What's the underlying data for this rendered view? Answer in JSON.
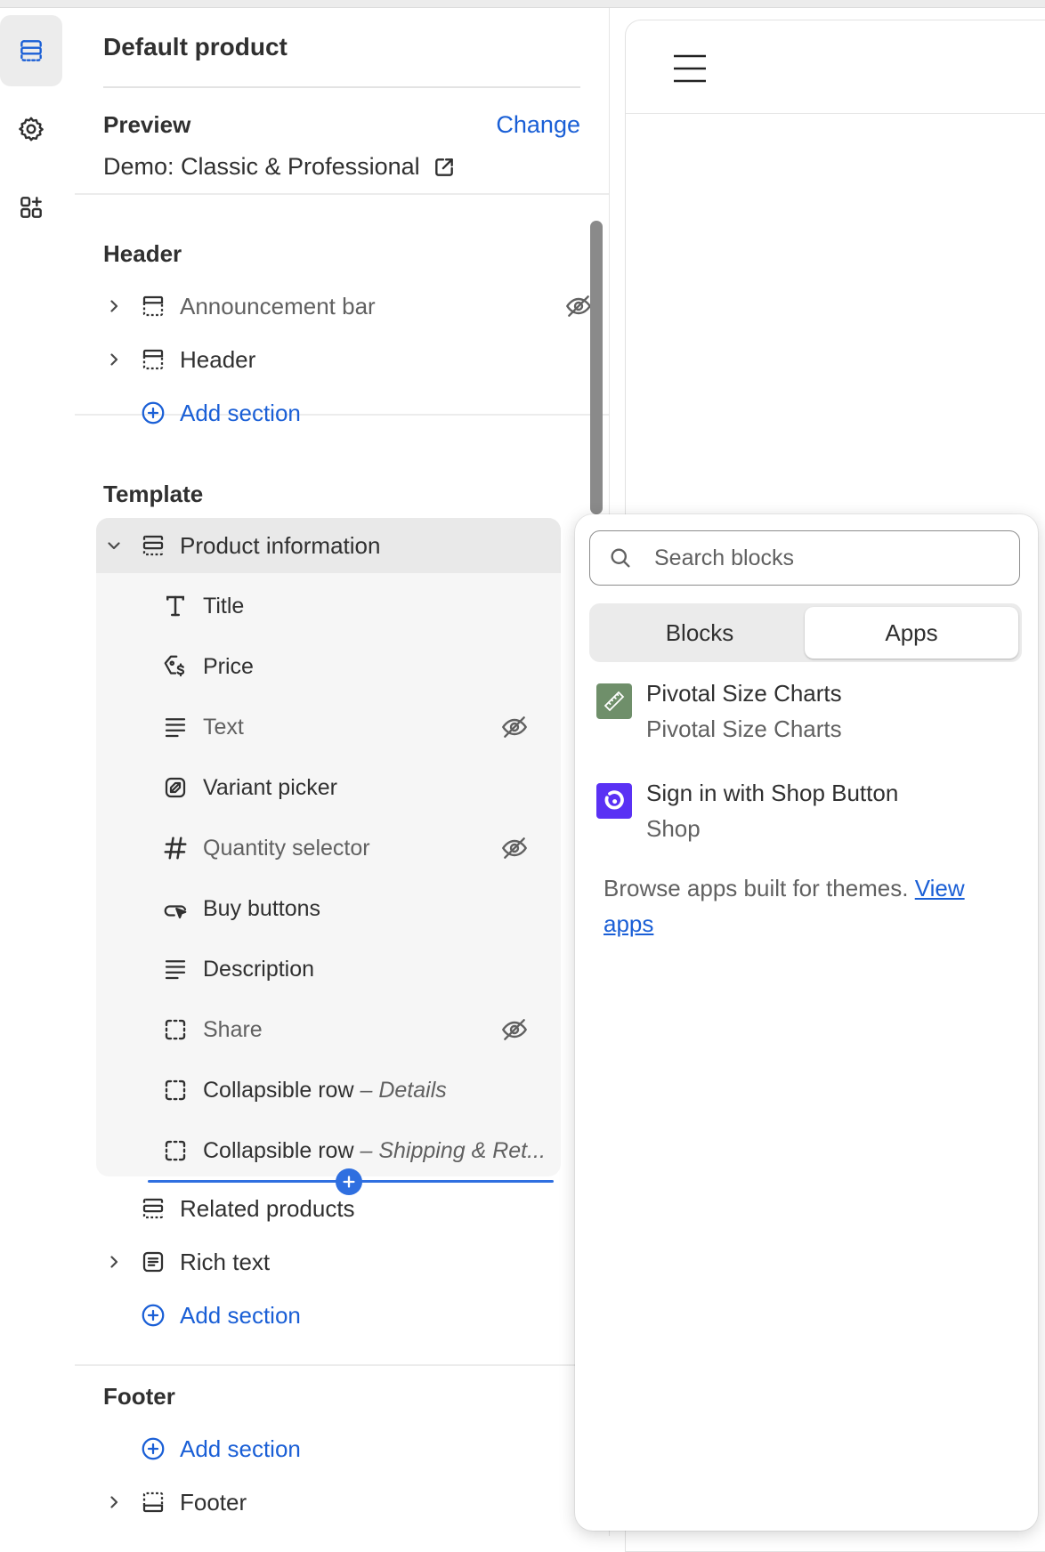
{
  "sidebar": {
    "title": "Default product",
    "preview_label": "Preview",
    "change_label": "Change",
    "preview_value": "Demo: Classic & Professional"
  },
  "header_group": {
    "label": "Header",
    "items": [
      {
        "label": "Announcement bar",
        "hidden": true
      },
      {
        "label": "Header",
        "hidden": false
      }
    ],
    "add_label": "Add section"
  },
  "template_group": {
    "label": "Template",
    "section": "Product information",
    "blocks": [
      {
        "label": "Title",
        "icon": "text-type-icon",
        "hidden": false,
        "sub": ""
      },
      {
        "label": "Price",
        "icon": "price-tag-icon",
        "hidden": false,
        "sub": ""
      },
      {
        "label": "Text",
        "icon": "text-lines-icon",
        "hidden": true,
        "sub": ""
      },
      {
        "label": "Variant picker",
        "icon": "variant-icon",
        "hidden": false,
        "sub": ""
      },
      {
        "label": "Quantity selector",
        "icon": "hash-icon",
        "hidden": true,
        "sub": ""
      },
      {
        "label": "Buy buttons",
        "icon": "cursor-button-icon",
        "hidden": false,
        "sub": ""
      },
      {
        "label": "Description",
        "icon": "text-lines-icon",
        "hidden": false,
        "sub": ""
      },
      {
        "label": "Share",
        "icon": "dashed-square-icon",
        "hidden": true,
        "sub": ""
      },
      {
        "label": "Collapsible row",
        "icon": "dashed-square-icon",
        "hidden": false,
        "sub": "– Details"
      },
      {
        "label": "Collapsible row",
        "icon": "dashed-square-icon",
        "hidden": false,
        "sub": "– Shipping & Ret..."
      }
    ],
    "items_after": [
      {
        "label": "Related products"
      },
      {
        "label": "Rich text"
      }
    ],
    "add_label": "Add section"
  },
  "footer_group": {
    "label": "Footer",
    "add_label": "Add section",
    "items": [
      {
        "label": "Footer"
      }
    ]
  },
  "popover": {
    "search_placeholder": "Search blocks",
    "tabs": [
      {
        "label": "Blocks",
        "selected": false
      },
      {
        "label": "Apps",
        "selected": true
      }
    ],
    "apps": [
      {
        "name": "Pivotal Size Charts",
        "vendor": "Pivotal Size Charts",
        "icon_color": "#6f8f6a"
      },
      {
        "name": "Sign in with Shop Button",
        "vendor": "Shop",
        "icon_color": "#5a31f4"
      }
    ],
    "browse_text": "Browse apps built for themes.",
    "browse_link": "View apps"
  },
  "colors": {
    "accent": "#1a5fd6",
    "insert_line": "#2f6fe0"
  }
}
